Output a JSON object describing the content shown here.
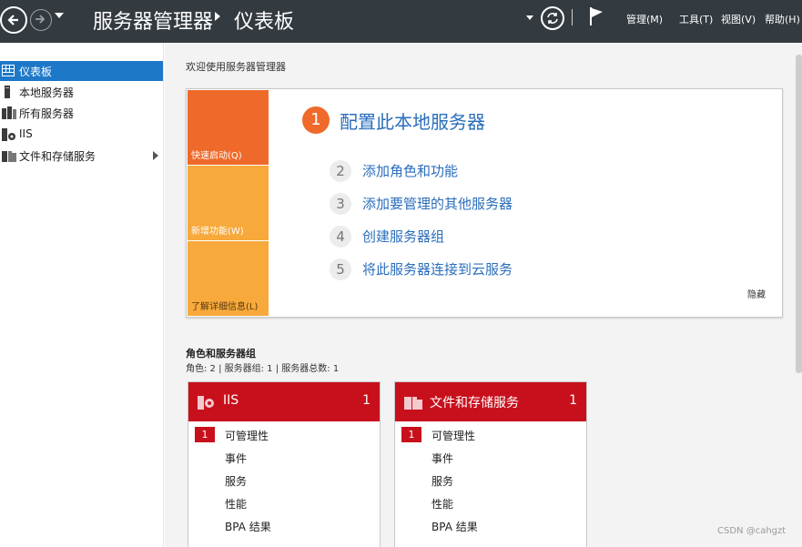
{
  "titlebar": {
    "app_title": "服务器管理器",
    "page_title": "仪表板",
    "menus": [
      "管理(M)",
      "工具(T)",
      "视图(V)",
      "帮助(H)"
    ]
  },
  "sidebar": {
    "items": [
      {
        "label": "仪表板",
        "icon": "dashboard-icon",
        "active": true
      },
      {
        "label": "本地服务器",
        "icon": "server-icon"
      },
      {
        "label": "所有服务器",
        "icon": "servers-icon"
      },
      {
        "label": "IIS",
        "icon": "iis-icon"
      },
      {
        "label": "文件和存储服务",
        "icon": "storage-icon",
        "expandable": true
      }
    ]
  },
  "main": {
    "welcome_title": "欢迎使用服务器管理器",
    "quickstart": {
      "tabs": [
        "快速启动(Q)",
        "新增功能(W)",
        "了解详细信息(L)"
      ],
      "steps": [
        {
          "num": "1",
          "label": "配置此本地服务器"
        },
        {
          "num": "2",
          "label": "添加角色和功能"
        },
        {
          "num": "3",
          "label": "添加要管理的其他服务器"
        },
        {
          "num": "4",
          "label": "创建服务器组"
        },
        {
          "num": "5",
          "label": "将此服务器连接到云服务"
        }
      ],
      "hide": "隐藏"
    },
    "roles": {
      "title": "角色和服务器组",
      "summary": "角色: 2 | 服务器组: 1 | 服务器总数: 1"
    },
    "tiles": [
      {
        "name": "IIS",
        "count": "1",
        "badge": "1",
        "rows": [
          "可管理性",
          "事件",
          "服务",
          "性能",
          "BPA 结果"
        ]
      },
      {
        "name": "文件和存储服务",
        "count": "1",
        "badge": "1",
        "rows": [
          "可管理性",
          "事件",
          "服务",
          "性能",
          "BPA 结果"
        ]
      }
    ]
  },
  "watermark": "CSDN @cahgzt",
  "colors": {
    "titlebar": "#333a40",
    "accent_blue": "#1e78c8",
    "quickstart_orange": "#ef6a2a",
    "quickstart_light": "#f7a93b",
    "tile_red": "#c8101c",
    "link_blue": "#2a6ebb"
  }
}
